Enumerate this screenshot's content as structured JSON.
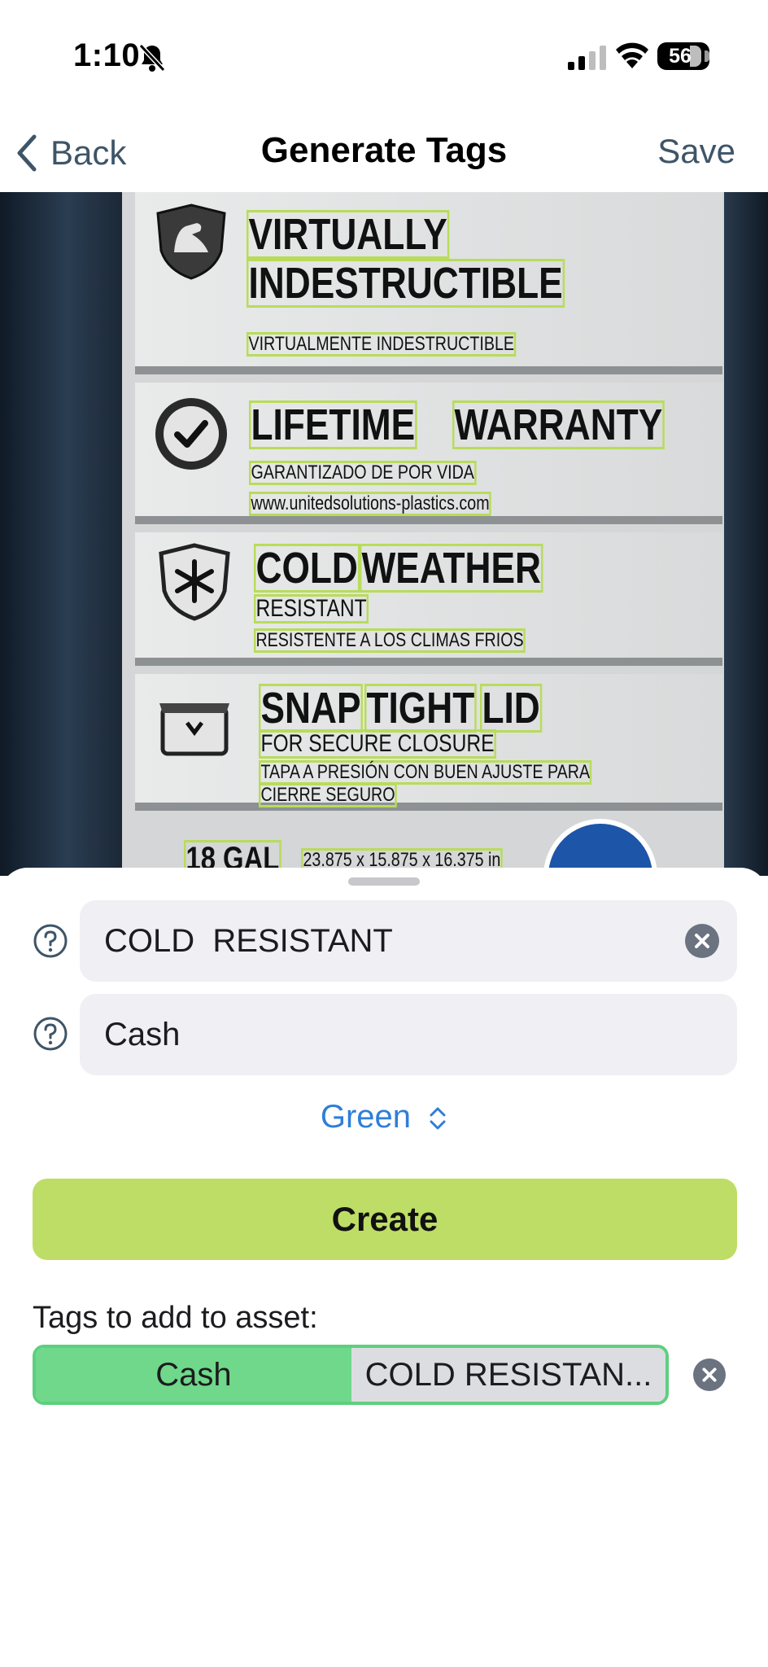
{
  "status_bar": {
    "time": "1:10",
    "battery": "56"
  },
  "nav": {
    "back_label": "Back",
    "title": "Generate Tags",
    "save_label": "Save"
  },
  "photo": {
    "ocr_words": {
      "virtually": "VIRTUALLY",
      "indestructible": "INDESTRUCTIBLE",
      "virtualmente": "VIRTUALMENTE INDESTRUCTIBLE",
      "lifetime": "LIFETIME",
      "warranty": "WARRANTY",
      "garantizado": "GARANTIZADO DE POR VIDA",
      "website": "www.unitedsolutions-plastics.com",
      "cold": "COLD",
      "weather": "WEATHER",
      "resistant": "RESISTANT",
      "resistente": "RESISTENTE A LOS CLIMAS FRIOS",
      "snap": "SNAP",
      "tight": "TIGHT",
      "lid": "LID",
      "secure": "FOR SECURE CLOSURE",
      "tapa": "TAPA A PRESIÓN CON BUEN AJUSTE PARA",
      "cierre": "CIERRE SEGURO",
      "gal": "18 GAL",
      "dims": "23.875 x 15.875 x 16.375 in"
    }
  },
  "form": {
    "tag_name_value": "COLD  RESISTANT",
    "category_value": "Cash",
    "color_value": "Green",
    "create_label": "Create"
  },
  "tags": {
    "label": "Tags to add to asset:",
    "items": [
      "Cash",
      "COLD RESISTAN..."
    ]
  },
  "colors": {
    "accent_green": "#bedd66",
    "tag_green": "#6fd88b",
    "link_blue": "#2f7ed8"
  },
  "icons": [
    "bell-slash-icon",
    "signal-icon",
    "wifi-icon",
    "battery-icon",
    "chevron-left-icon",
    "question-circle-icon",
    "clear-circle-icon",
    "chevron-up-down-icon"
  ]
}
